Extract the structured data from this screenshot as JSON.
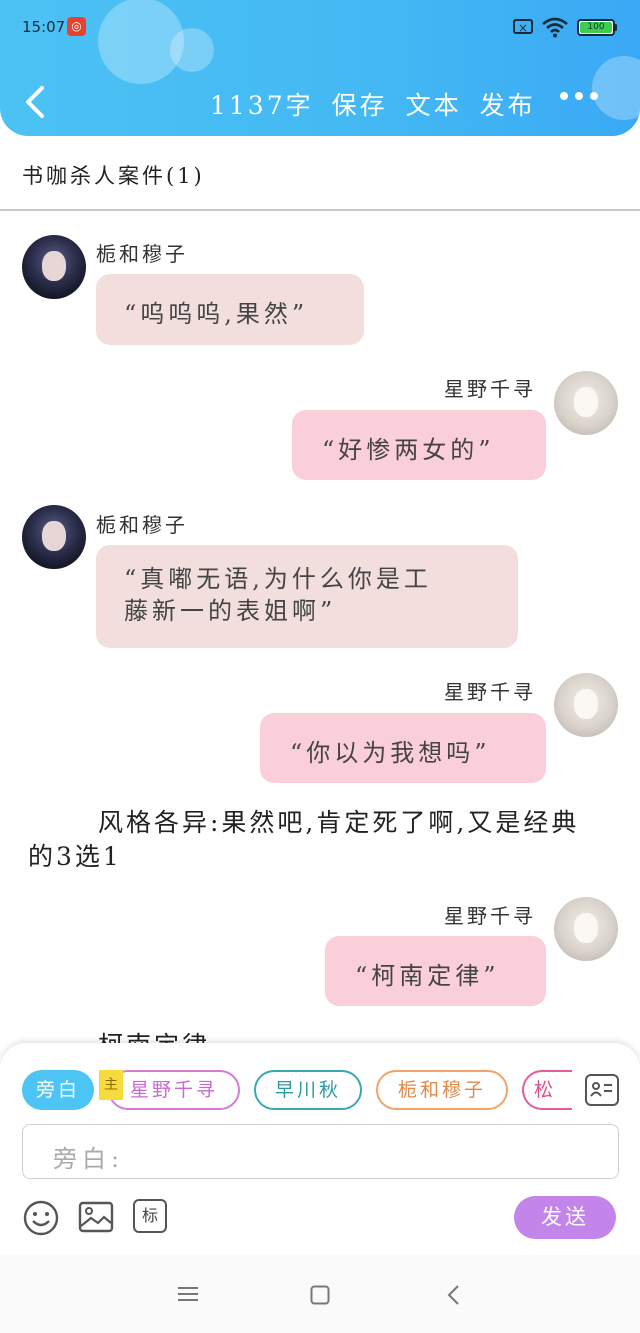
{
  "status_bar": {
    "time": "15:07",
    "battery": "100"
  },
  "header": {
    "word_count": "1137字",
    "save": "保存",
    "text": "文本",
    "publish": "发布"
  },
  "doc_title": "书咖杀人案件(1)",
  "messages": [
    {
      "speaker": "栀和穆子",
      "text": "“呜呜呜,果然”",
      "side": "left"
    },
    {
      "speaker": "星野千寻",
      "text": "“好惨两女的”",
      "side": "right"
    },
    {
      "speaker": "栀和穆子",
      "text_line1": "“真嘟无语,为什么你是工",
      "text_line2": "藤新一的表姐啊”",
      "side": "left"
    },
    {
      "speaker": "星野千寻",
      "text": "“你以为我想吗”",
      "side": "right"
    },
    {
      "speaker": "星野千寻",
      "text": "“柯南定律”",
      "side": "right"
    }
  ],
  "narration": "风格各异:果然吧,肯定死了啊,又是经典的3选1",
  "narration_partial": "柯南定律:",
  "role_chips": {
    "narrator": "旁白",
    "main_tag": "主",
    "role_a": "星野千寻",
    "role_b": "早川秋",
    "role_c": "栀和穆子",
    "role_d": "松"
  },
  "input": {
    "placeholder": "旁白:"
  },
  "tools": {
    "tag_label": "标"
  },
  "send_label": "发送",
  "colors": {
    "header": "#43b8f3",
    "bubble_left": "#f3dede",
    "bubble_right": "#fbcfd9",
    "send": "#c485ea"
  }
}
